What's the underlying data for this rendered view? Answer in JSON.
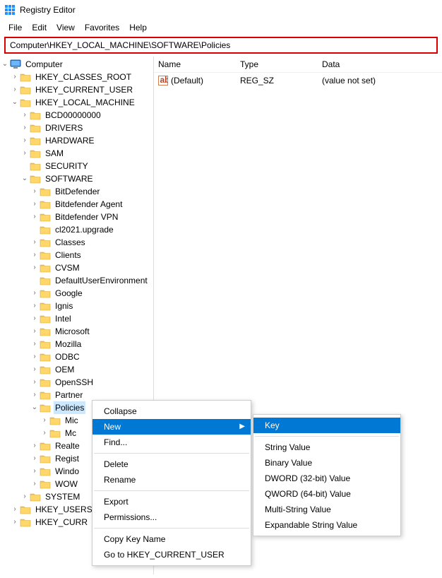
{
  "title": "Registry Editor",
  "menu": [
    "File",
    "Edit",
    "View",
    "Favorites",
    "Help"
  ],
  "address": "Computer\\HKEY_LOCAL_MACHINE\\SOFTWARE\\Policies",
  "tree": {
    "root": "Computer",
    "hives": [
      {
        "name": "HKEY_CLASSES_ROOT",
        "exp": ">",
        "depth": 1
      },
      {
        "name": "HKEY_CURRENT_USER",
        "exp": ">",
        "depth": 1
      },
      {
        "name": "HKEY_LOCAL_MACHINE",
        "exp": "v",
        "depth": 1
      },
      {
        "name": "BCD00000000",
        "exp": ">",
        "depth": 2
      },
      {
        "name": "DRIVERS",
        "exp": ">",
        "depth": 2
      },
      {
        "name": "HARDWARE",
        "exp": ">",
        "depth": 2
      },
      {
        "name": "SAM",
        "exp": ">",
        "depth": 2
      },
      {
        "name": "SECURITY",
        "exp": "",
        "depth": 2
      },
      {
        "name": "SOFTWARE",
        "exp": "v",
        "depth": 2
      },
      {
        "name": "BitDefender",
        "exp": ">",
        "depth": 3
      },
      {
        "name": "Bitdefender Agent",
        "exp": ">",
        "depth": 3
      },
      {
        "name": "Bitdefender VPN",
        "exp": ">",
        "depth": 3
      },
      {
        "name": "cl2021.upgrade",
        "exp": "",
        "depth": 3
      },
      {
        "name": "Classes",
        "exp": ">",
        "depth": 3
      },
      {
        "name": "Clients",
        "exp": ">",
        "depth": 3
      },
      {
        "name": "CVSM",
        "exp": ">",
        "depth": 3
      },
      {
        "name": "DefaultUserEnvironment",
        "exp": "",
        "depth": 3
      },
      {
        "name": "Google",
        "exp": ">",
        "depth": 3
      },
      {
        "name": "Ignis",
        "exp": ">",
        "depth": 3
      },
      {
        "name": "Intel",
        "exp": ">",
        "depth": 3
      },
      {
        "name": "Microsoft",
        "exp": ">",
        "depth": 3
      },
      {
        "name": "Mozilla",
        "exp": ">",
        "depth": 3
      },
      {
        "name": "ODBC",
        "exp": ">",
        "depth": 3
      },
      {
        "name": "OEM",
        "exp": ">",
        "depth": 3
      },
      {
        "name": "OpenSSH",
        "exp": ">",
        "depth": 3
      },
      {
        "name": "Partner",
        "exp": ">",
        "depth": 3
      },
      {
        "name": "Policies",
        "exp": "v",
        "depth": 3,
        "sel": true
      },
      {
        "name": "Mic",
        "exp": ">",
        "depth": 4
      },
      {
        "name": "Mc",
        "exp": ">",
        "depth": 4
      },
      {
        "name": "Realte",
        "exp": ">",
        "depth": 3
      },
      {
        "name": "Regist",
        "exp": ">",
        "depth": 3
      },
      {
        "name": "Windo",
        "exp": ">",
        "depth": 3
      },
      {
        "name": "WOW",
        "exp": ">",
        "depth": 3
      },
      {
        "name": "SYSTEM",
        "exp": ">",
        "depth": 2
      },
      {
        "name": "HKEY_USERS",
        "exp": ">",
        "depth": 1
      },
      {
        "name": "HKEY_CURR",
        "exp": ">",
        "depth": 1
      }
    ]
  },
  "cols": {
    "name": "Name",
    "type": "Type",
    "data": "Data"
  },
  "valrow": {
    "name": "(Default)",
    "type": "REG_SZ",
    "data": "(value not set)"
  },
  "ctx1": {
    "collapse": "Collapse",
    "new": "New",
    "find": "Find...",
    "delete": "Delete",
    "rename": "Rename",
    "export": "Export",
    "permissions": "Permissions...",
    "copy": "Copy Key Name",
    "goto": "Go to HKEY_CURRENT_USER"
  },
  "ctx2": {
    "key": "Key",
    "string": "String Value",
    "binary": "Binary Value",
    "dword": "DWORD (32-bit) Value",
    "qword": "QWORD (64-bit) Value",
    "multi": "Multi-String Value",
    "expand": "Expandable String Value"
  }
}
